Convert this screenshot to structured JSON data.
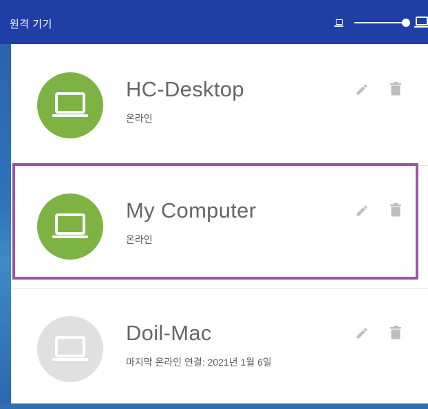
{
  "header": {
    "title": "원격 기기",
    "size_slider_value": 1.0
  },
  "devices": [
    {
      "name": "HC-Desktop",
      "status": "온라인",
      "online": true,
      "avatar_icon": "laptop-icon",
      "edit_icon": "pencil-icon",
      "delete_icon": "trash-icon"
    },
    {
      "name": "My Computer",
      "status": "온라인",
      "online": true,
      "selected": true,
      "avatar_icon": "laptop-icon",
      "edit_icon": "pencil-icon",
      "delete_icon": "trash-icon"
    },
    {
      "name": "Doil-Mac",
      "status": "마지막 온라인 연결: 2021년 1월 6일",
      "online": false,
      "avatar_icon": "laptop-icon",
      "edit_icon": "pencil-icon",
      "delete_icon": "trash-icon"
    }
  ],
  "colors": {
    "header_bg": "#1f3fa6",
    "online_avatar": "#7cb342",
    "offline_avatar": "#e0e0e0",
    "selection_border": "#9a55a0"
  }
}
